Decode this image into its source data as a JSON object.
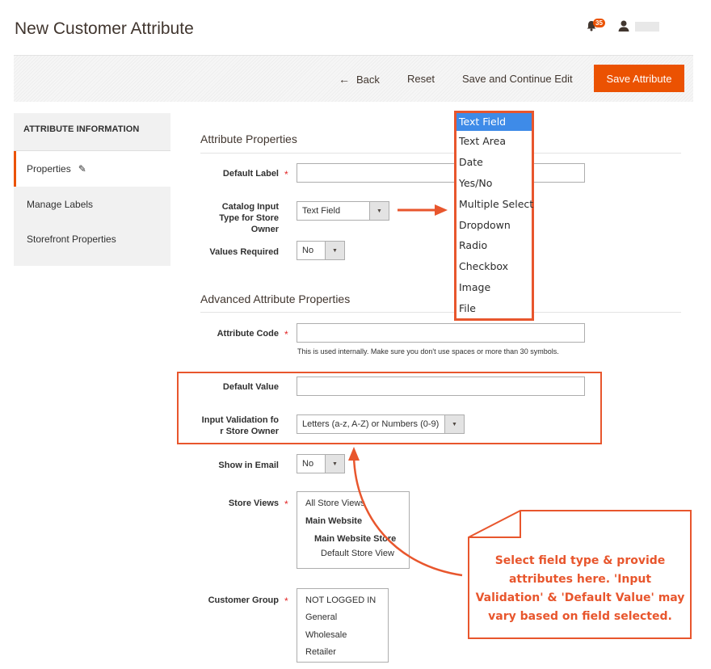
{
  "page": {
    "title": "New Customer Attribute"
  },
  "header": {
    "notifications_count": "35"
  },
  "toolbar": {
    "back_label": "Back",
    "reset_label": "Reset",
    "save_continue_label": "Save and Continue Edit",
    "save_label": "Save Attribute"
  },
  "sidebar": {
    "heading": "ATTRIBUTE INFORMATION",
    "items": [
      {
        "label": "Properties",
        "active": true
      },
      {
        "label": "Manage Labels",
        "active": false
      },
      {
        "label": "Storefront Properties",
        "active": false
      }
    ]
  },
  "attribute_properties": {
    "title": "Attribute Properties",
    "default_label": {
      "label": "Default Label",
      "value": ""
    },
    "catalog_input_type": {
      "label": "Catalog Input Type for Store Owner",
      "value": "Text Field"
    },
    "values_required": {
      "label": "Values Required",
      "value": "No"
    }
  },
  "advanced": {
    "title": "Advanced Attribute Properties",
    "attribute_code": {
      "label": "Attribute Code",
      "value": "",
      "note": "This is used internally. Make sure you don't use spaces or more than 30 symbols."
    },
    "default_value": {
      "label": "Default Value",
      "value": ""
    },
    "input_validation": {
      "label_line1": "Input Validation fo",
      "label_line2": "r Store Owner",
      "value": "Letters (a-z, A-Z) or Numbers (0-9)"
    },
    "show_in_email": {
      "label": "Show in Email",
      "value": "No"
    },
    "store_views": {
      "label": "Store Views",
      "options": [
        "All Store Views",
        "Main Website",
        "Main Website Store",
        "Default Store View"
      ]
    },
    "customer_group": {
      "label": "Customer Group",
      "options": [
        "NOT LOGGED IN",
        "General",
        "Wholesale",
        "Retailer"
      ]
    }
  },
  "input_type_dropdown": {
    "options": [
      "Text Field",
      "Text Area",
      "Date",
      "Yes/No",
      "Multiple Select",
      "Dropdown",
      "Radio",
      "Checkbox",
      "Image",
      "File"
    ],
    "selected": "Text Field"
  },
  "callout": {
    "line1": "Select field type & provide",
    "line2": "attributes here. 'Input",
    "line3": "Validation' & 'Default Value' may",
    "line4": "vary based on field selected."
  },
  "colors": {
    "accent": "#eb5202",
    "annotation": "#e8562d",
    "selection": "#3e8be8"
  }
}
